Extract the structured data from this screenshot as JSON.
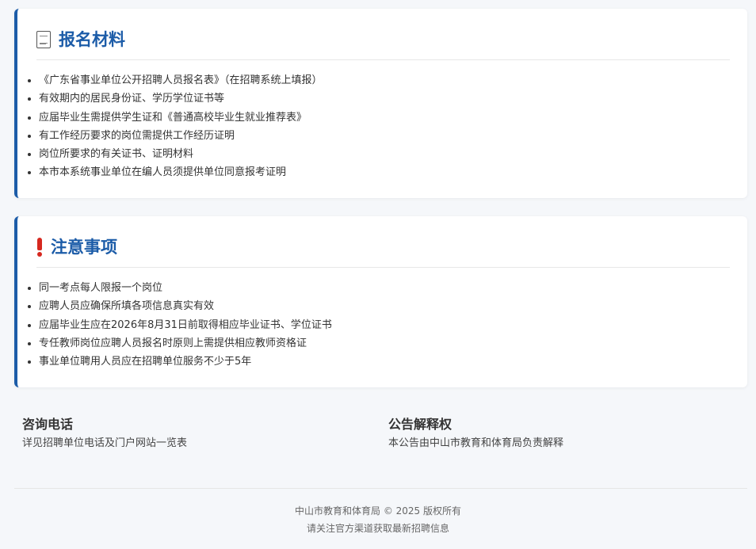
{
  "materials": {
    "title": "报名材料",
    "icon": "document-icon",
    "items": [
      "《广东省事业单位公开招聘人员报名表》（在招聘系统上填报）",
      "有效期内的居民身份证、学历学位证书等",
      "应届毕业生需提供学生证和《普通高校毕业生就业推荐表》",
      "有工作经历要求的岗位需提供工作经历证明",
      "岗位所要求的有关证书、证明材料",
      "本市本系统事业单位在编人员须提供单位同意报考证明"
    ]
  },
  "notes": {
    "title": "注意事项",
    "icon": "exclamation-icon",
    "items": [
      "同一考点每人限报一个岗位",
      "应聘人员应确保所填各项信息真实有效",
      "应届毕业生应在2026年8月31日前取得相应毕业证书、学位证书",
      "专任教师岗位应聘人员报名时原则上需提供相应教师资格证",
      "事业单位聘用人员应在招聘单位服务不少于5年"
    ]
  },
  "contact": {
    "title": "咨询电话",
    "text": "详见招聘单位电话及门户网站一览表"
  },
  "rights": {
    "title": "公告解释权",
    "text": "本公告由中山市教育和体育局负责解释"
  },
  "footer": {
    "copyright": "中山市教育和体育局 © 2025 版权所有",
    "notice": "请关注官方渠道获取最新招聘信息"
  },
  "colors": {
    "accent": "#1c5ca8",
    "alert": "#d6281f",
    "background": "#f5f7fa"
  }
}
